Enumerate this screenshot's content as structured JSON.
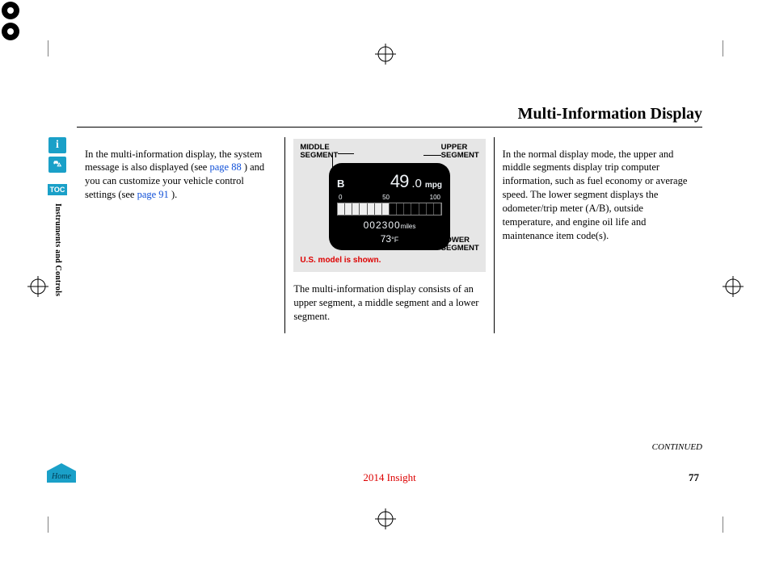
{
  "page": {
    "title": "Multi-Information Display",
    "continued": "CONTINUED",
    "model_year": "2014 Insight",
    "page_number": "77"
  },
  "sidebar": {
    "info_glyph": "i",
    "car_glyph": "⛍",
    "toc_label": "TOC",
    "section_label": "Instruments and Controls",
    "home_label": "Home"
  },
  "col1": {
    "text_a": "In the multi-information display, the system message is also displayed (see ",
    "link_a": "page 88",
    "text_b": " ) and you can customize your vehicle control settings (see ",
    "link_b": "page 91",
    "text_c": " )."
  },
  "illustration": {
    "label_middle": "MIDDLE\nSEGMENT",
    "label_upper": "UPPER\nSEGMENT",
    "label_lower": "LOWER\nSEGMENT",
    "note": "U.S. model is shown.",
    "device": {
      "trip_letter": "B",
      "mpg_int": "49",
      "mpg_dec": ".0",
      "mpg_unit": "mpg",
      "scale_0": "0",
      "scale_50": "50",
      "scale_100": "100",
      "odo_value": "002300",
      "odo_unit": "miles",
      "temp_value": "73",
      "temp_unit": "°F"
    }
  },
  "col2": {
    "caption": "The multi-information display consists of an upper segment, a middle segment and a lower segment."
  },
  "col3": {
    "body": "In the normal display mode, the upper and middle segments display trip computer information, such as fuel economy or average speed. The lower segment displays the odometer/trip meter (A/B), outside temperature, and engine oil life and maintenance item code(s)."
  }
}
